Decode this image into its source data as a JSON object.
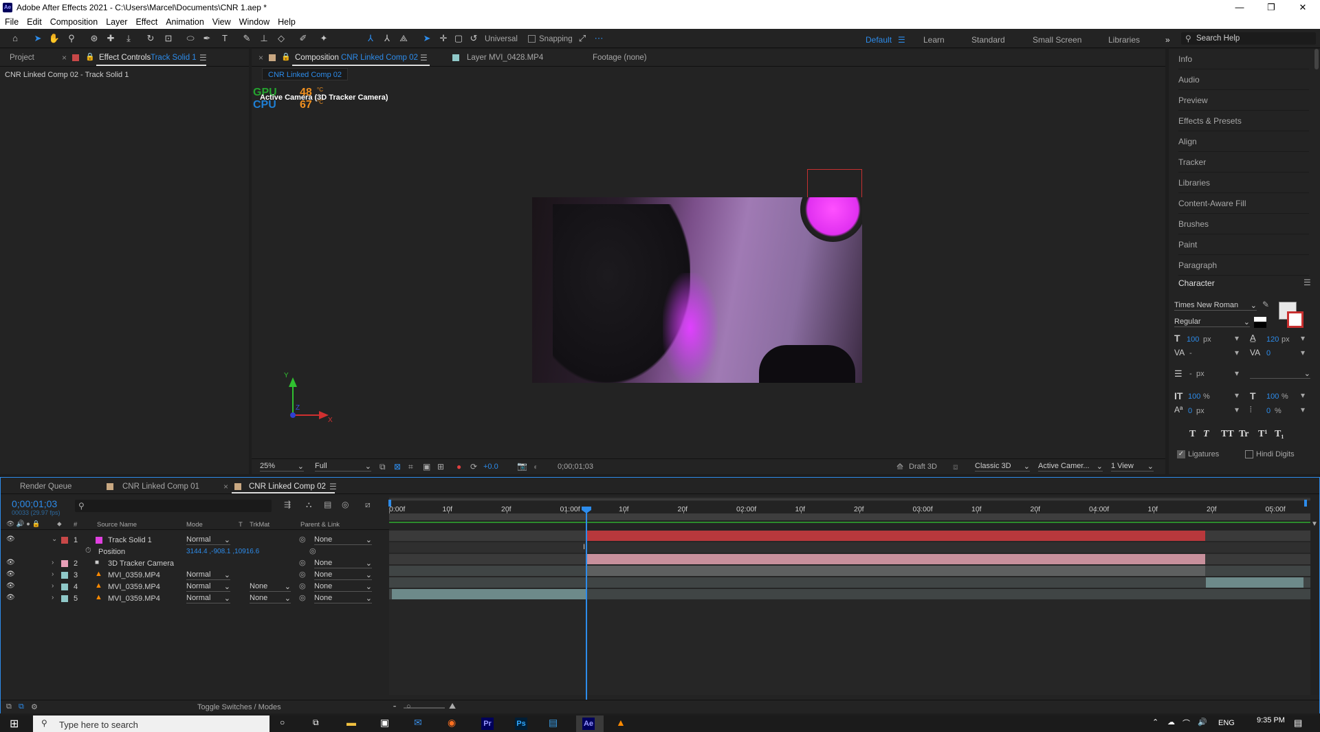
{
  "window": {
    "app_icon": "Ae",
    "title": "Adobe After Effects 2021 - C:\\Users\\Marcel\\Documents\\CNR 1.aep *",
    "minimize": "—",
    "maximize": "❐",
    "close": "✕"
  },
  "menu": [
    "File",
    "Edit",
    "Composition",
    "Layer",
    "Effect",
    "Animation",
    "View",
    "Window",
    "Help"
  ],
  "toolbar": {
    "universal": "Universal",
    "snapping": "Snapping"
  },
  "workspaces": [
    "Default",
    "Learn",
    "Standard",
    "Small Screen",
    "Libraries"
  ],
  "search_help": {
    "placeholder": "Search Help"
  },
  "left_panel": {
    "tab_project": "Project",
    "tab_effect_controls": "Effect Controls",
    "effect_controls_target": "Track Solid 1",
    "subtitle": "CNR  Linked Comp 02 - Track Solid 1"
  },
  "viewer": {
    "tab_composition": "Composition",
    "composition_name": "CNR  Linked Comp 02",
    "tab_layer": "Layer  MVI_0428.MP4",
    "tab_footage": "Footage  (none)",
    "breadcrumb": "CNR  Linked Comp 02",
    "overlay_gpu_label": "GPU",
    "overlay_gpu_value": "48",
    "overlay_cpu_label": "CPU",
    "overlay_cpu_value": "67",
    "overlay_unit": "°C",
    "camera_label": "Active Camera (3D Tracker Camera)",
    "axis_y": "Y",
    "axis_x": "X",
    "axis_z": "Z",
    "zoom": "25%",
    "resolution": "Full",
    "exposure": "+0.0",
    "timecode": "0;00;01;03",
    "renderer_label": "Draft 3D",
    "renderer": "Classic 3D",
    "camera_select": "Active Camer...",
    "views": "1 View"
  },
  "right_panel": {
    "items": [
      "Info",
      "Audio",
      "Preview",
      "Effects & Presets",
      "Align",
      "Tracker",
      "Libraries",
      "Content-Aware Fill",
      "Brushes",
      "Paint",
      "Paragraph"
    ],
    "character": {
      "title": "Character",
      "font": "Times New Roman",
      "style": "Regular",
      "size": "100",
      "size_unit": "px",
      "leading": "120",
      "leading_unit": "px",
      "kerning": "-",
      "tracking": "0",
      "stroke_width": "-",
      "stroke_unit": "px",
      "vscale": "100",
      "hscale": "100",
      "pct": "%",
      "baseline": "0",
      "baseline_unit": "px",
      "tsume": "0",
      "tsume_unit": "%",
      "type_buttons": [
        "T",
        "T",
        "TT",
        "Tr",
        "T¹",
        "T₁"
      ],
      "ligatures": "Ligatures",
      "hindi_digits": "Hindi Digits"
    }
  },
  "timeline": {
    "tabs": [
      "Render Queue",
      "CNR  Linked Comp 01",
      "CNR  Linked Comp 02"
    ],
    "current_time": "0;00;01;03",
    "frame_info": "00033 (29.97 fps)",
    "columns": {
      "num": "#",
      "source_name": "Source Name",
      "mode": "Mode",
      "t": "T",
      "trkmat": "TrkMat",
      "parent": "Parent & Link"
    },
    "ruler": [
      "0:00f",
      "10f",
      "20f",
      "01:00f",
      "10f",
      "20f",
      "02:00f",
      "10f",
      "20f",
      "03:00f",
      "10f",
      "20f",
      "04:00f",
      "10f",
      "20f",
      "05:00f"
    ],
    "layers": [
      {
        "num": "1",
        "name": "Track Solid 1",
        "mode": "Normal",
        "trkmat": "",
        "parent": "None",
        "color": "#e040e0",
        "label": "#c84848"
      },
      {
        "num": "2",
        "name": "3D Tracker Camera",
        "mode": "",
        "trkmat": "",
        "parent": "None",
        "color": "#e8a0b8",
        "label": "#e8a0b8"
      },
      {
        "num": "3",
        "name": "MVI_0359.MP4",
        "mode": "Normal",
        "trkmat": "",
        "parent": "None",
        "color": "#8fc8c8",
        "label": "#8fc8c8"
      },
      {
        "num": "4",
        "name": "MVI_0359.MP4",
        "mode": "Normal",
        "trkmat": "None",
        "parent": "None",
        "color": "#8fc8c8",
        "label": "#8fc8c8"
      },
      {
        "num": "5",
        "name": "MVI_0359.MP4",
        "mode": "Normal",
        "trkmat": "None",
        "parent": "None",
        "color": "#8fc8c8",
        "label": "#8fc8c8"
      }
    ],
    "position_prop": {
      "name": "Position",
      "value": "3144.4 ,-908.1 ,10916.6"
    },
    "toggle": "Toggle Switches / Modes"
  },
  "taskbar": {
    "search_placeholder": "Type here to search",
    "lang": "ENG",
    "time": "9:35 PM",
    "apps": [
      "Pr",
      "Ps",
      "Ae"
    ]
  },
  "colors": {
    "accent": "#2d8ceb",
    "panel": "#232323",
    "bg": "#1d1d1d",
    "track_red": "#b8383c",
    "track_pink": "#c8909c",
    "track_teal": "#5e7c7c"
  }
}
